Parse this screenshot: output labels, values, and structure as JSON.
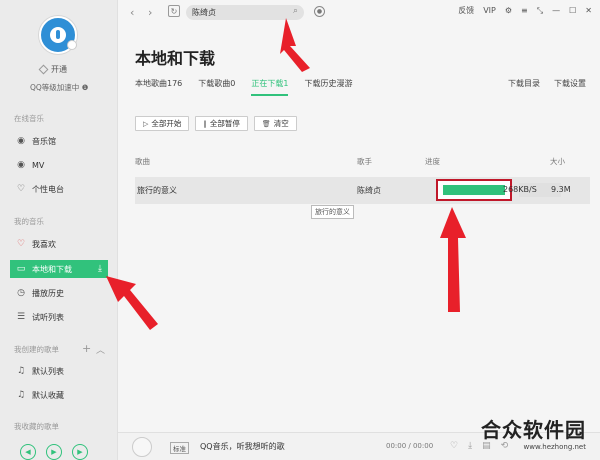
{
  "sidebar": {
    "open_vip": "开通",
    "level": "QQ等级加速中 ❶",
    "section_online": "在线音乐",
    "section_mine": "我的音乐",
    "section_created": "我创建的歌单",
    "section_collected": "我收藏的歌单",
    "items": [
      {
        "label": "音乐馆",
        "icon": "music-hall-icon",
        "glyph": "♪"
      },
      {
        "label": "MV",
        "icon": "mv-icon",
        "glyph": "▶"
      },
      {
        "label": "个性电台",
        "icon": "radio-icon",
        "glyph": "♡"
      },
      {
        "label": "我喜欢",
        "icon": "heart-icon",
        "glyph": "♡"
      },
      {
        "label": "本地和下载",
        "icon": "monitor-icon",
        "glyph": "▭"
      },
      {
        "label": "播放历史",
        "icon": "clock-icon",
        "glyph": "◷"
      },
      {
        "label": "试听列表",
        "icon": "playlist-icon",
        "glyph": "☰"
      },
      {
        "label": "默认列表",
        "icon": "note-icon",
        "glyph": "♫"
      },
      {
        "label": "默认收藏",
        "icon": "note-icon",
        "glyph": "♫"
      }
    ],
    "add_glyph": "+",
    "collapse_glyph": "︿"
  },
  "topbar": {
    "search_value": "陈绮贞",
    "feedback": "反馈",
    "vip": "VIP",
    "colors": {
      "accent": "#31c27c",
      "highlight": "#c0182a"
    }
  },
  "page": {
    "title": "本地和下载",
    "tabs": [
      "本地歌曲176",
      "下载歌曲0",
      "正在下载1",
      "下载历史漫游"
    ],
    "active_tab": 2,
    "links": [
      "下载目录",
      "下载设置"
    ],
    "actions": {
      "start_all": "全部开始",
      "pause_all": "全部暂停",
      "clear": "清空"
    }
  },
  "table": {
    "headers": {
      "song": "歌曲",
      "artist": "歌手",
      "progress": "进度",
      "size": "大小"
    },
    "rows": [
      {
        "song": "旅行的意义",
        "artist": "陈绮贞",
        "progress": 1.0,
        "speed": "268KB/S",
        "size": "9.3M"
      }
    ],
    "tooltip": "旅行的意义"
  },
  "bottom": {
    "quality": "标准",
    "song_info": "QQ音乐，听我想听的歌",
    "time": "00:00 / 00:00"
  },
  "watermark": {
    "main": "合众软件园",
    "sub": "www.hezhong.net"
  }
}
